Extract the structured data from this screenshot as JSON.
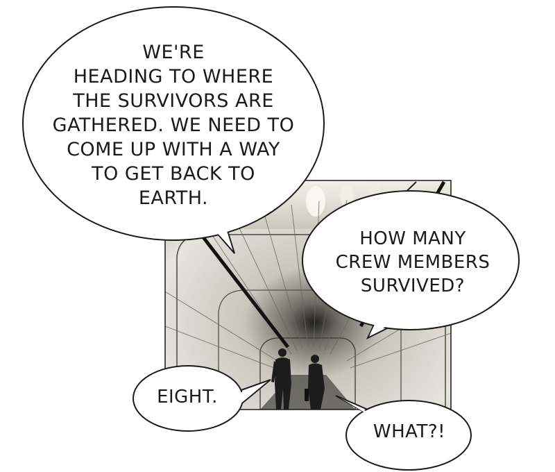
{
  "speech_bubbles": [
    {
      "speaker": "left",
      "lines": [
        "WE'RE",
        "HEADING TO WHERE",
        "THE SURVIVORS ARE",
        "GATHERED. WE NEED TO",
        "COME UP WITH A WAY",
        "TO GET BACK TO",
        "EARTH."
      ]
    },
    {
      "speaker": "right",
      "lines": [
        "HOW MANY",
        "CREW MEMBERS",
        "SURVIVED?"
      ]
    },
    {
      "speaker": "left",
      "lines": [
        "EIGHT."
      ]
    },
    {
      "speaker": "right",
      "lines": [
        "WHAT?!"
      ]
    }
  ],
  "colors": {
    "bubble_fill": "#ffffff",
    "bubble_stroke": "#1a1a1a",
    "text": "#1a1a1a",
    "corridor_wall": "#d9d7d0",
    "corridor_shadow": "#8f8c84",
    "figure": "#1c1c1c"
  }
}
